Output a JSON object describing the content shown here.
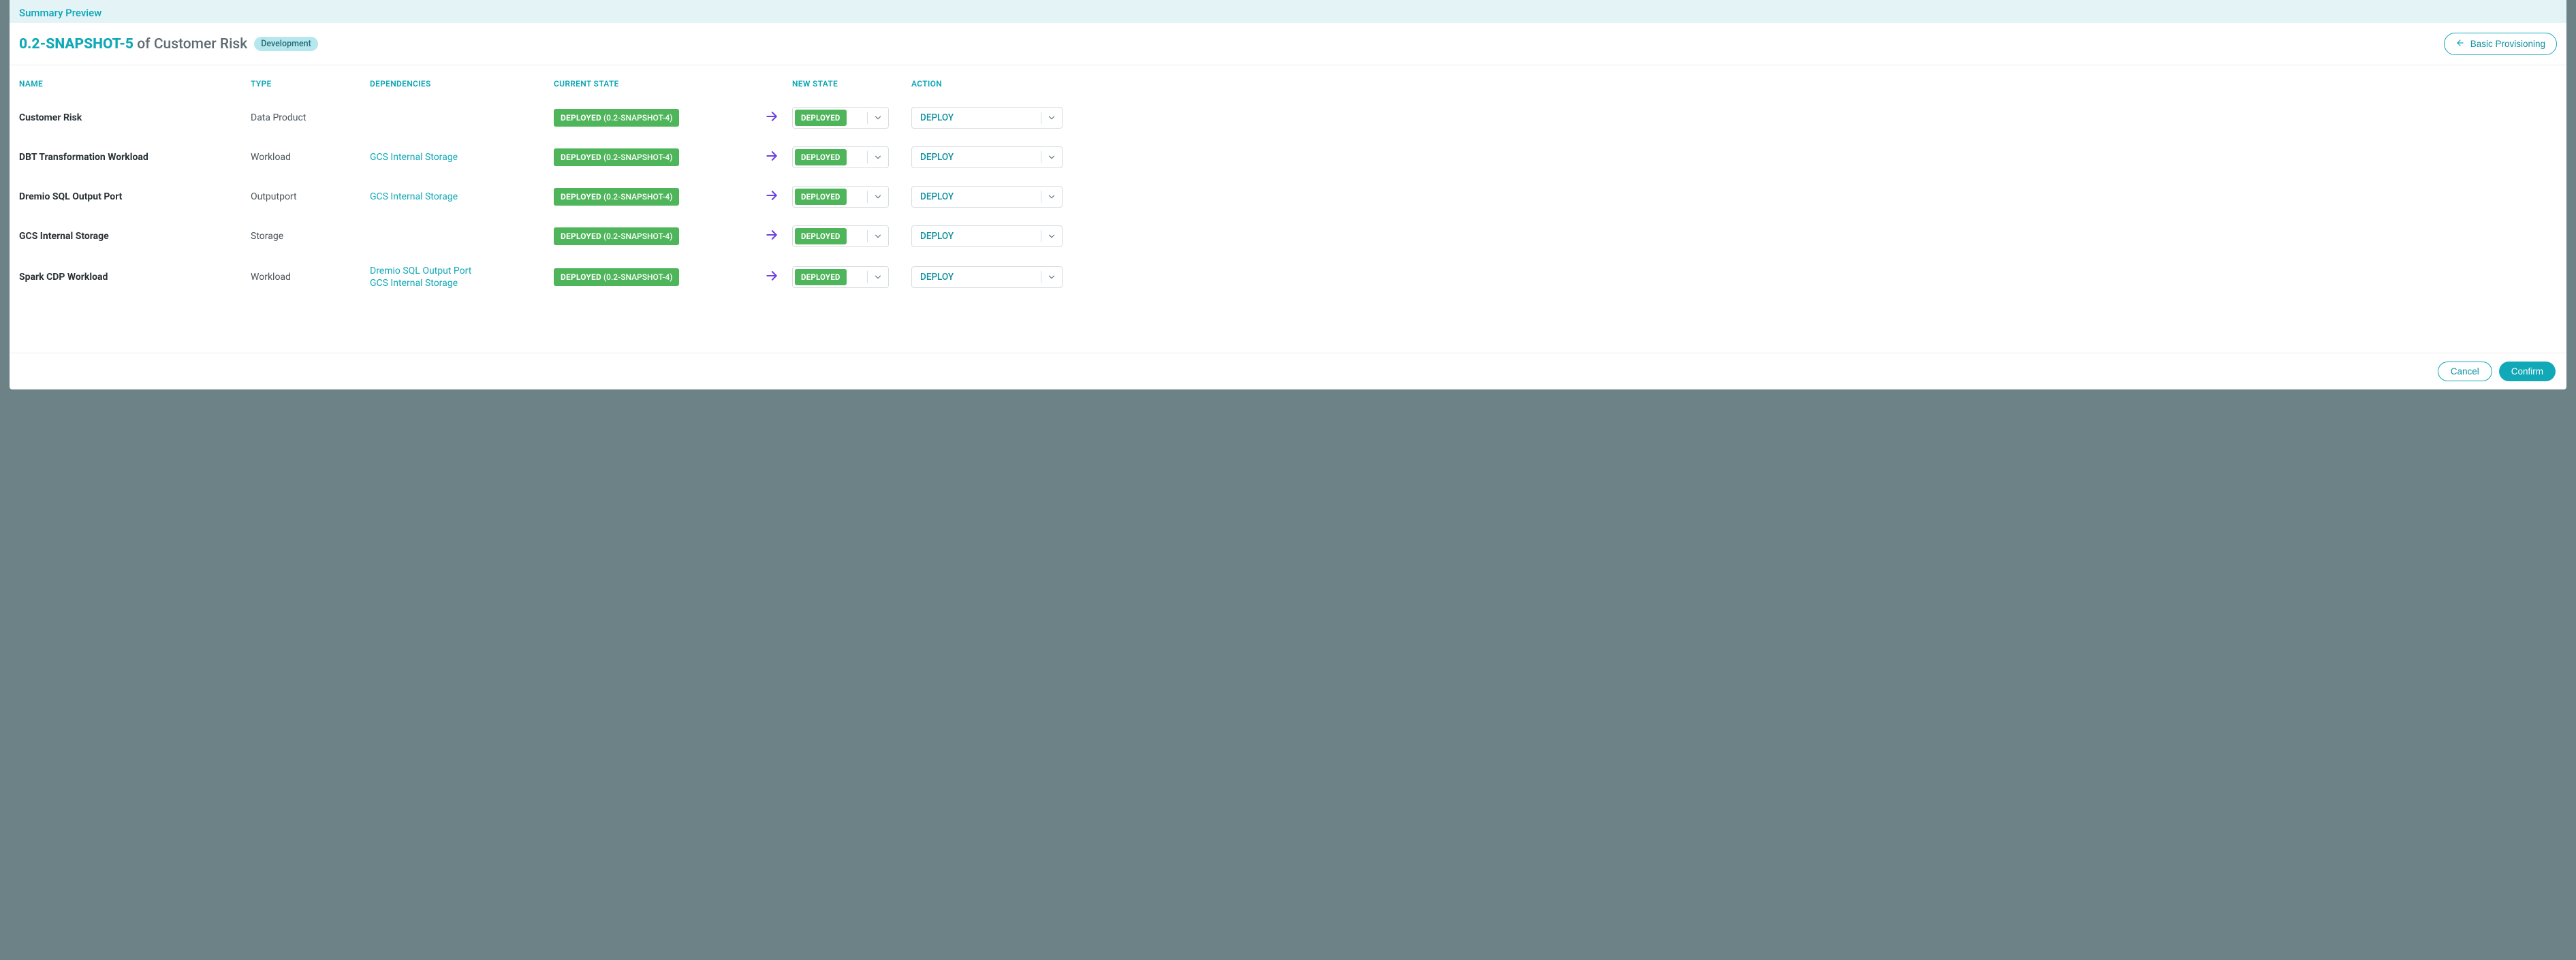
{
  "summary_label": "Summary Preview",
  "header": {
    "version": "0.2-SNAPSHOT-5",
    "of_text": " of Customer Risk",
    "env_badge": "Development",
    "back_button": "Basic Provisioning"
  },
  "columns": {
    "name": "NAME",
    "type": "TYPE",
    "deps": "DEPENDENCIES",
    "current": "CURRENT STATE",
    "newstate": "NEW STATE",
    "action": "ACTION"
  },
  "state_labels": {
    "deployed": "DEPLOYED",
    "version_suffix": " (0.2-SNAPSHOT-4)"
  },
  "action_default": "DEPLOY",
  "rows": [
    {
      "name": "Customer Risk",
      "type": "Data Product",
      "deps": []
    },
    {
      "name": "DBT Transformation Workload",
      "type": "Workload",
      "deps": [
        "GCS Internal Storage"
      ]
    },
    {
      "name": "Dremio SQL Output Port",
      "type": "Outputport",
      "deps": [
        "GCS Internal Storage"
      ]
    },
    {
      "name": "GCS Internal Storage",
      "type": "Storage",
      "deps": []
    },
    {
      "name": "Spark CDP Workload",
      "type": "Workload",
      "deps": [
        "Dremio SQL Output Port",
        "GCS Internal Storage"
      ]
    }
  ],
  "footer": {
    "cancel": "Cancel",
    "confirm": "Confirm"
  }
}
